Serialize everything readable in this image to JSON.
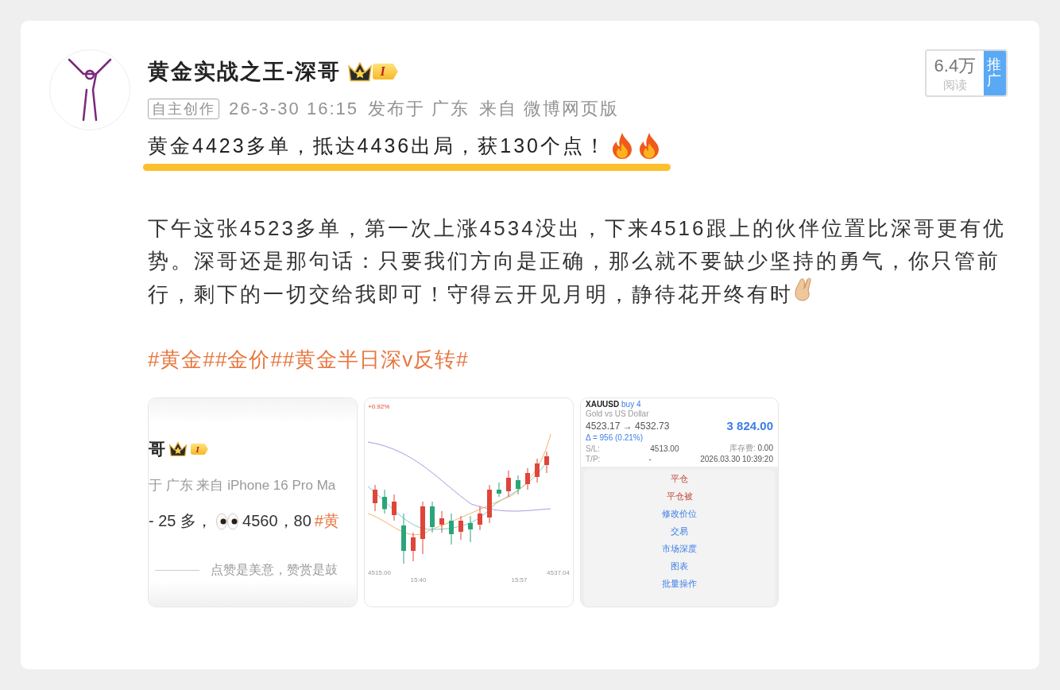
{
  "author": {
    "name": "黄金实战之王-深哥",
    "badge_level": "I"
  },
  "meta": {
    "tag": "自主创作",
    "time": "26-3-30 16:15",
    "location": "发布于 广东",
    "source": "来自 微博网页版"
  },
  "stats": {
    "reads": "6.4万",
    "reads_label": "阅读",
    "promote": "推广"
  },
  "headline": "黄金4423多单，抵达4436出局，获130个点！",
  "body": "下午这张4523多单，第一次上涨4534没出，下来4516跟上的伙伴位置比深哥更有优势。深哥还是那句话：只要我们方向是正确，那么就不要缺少坚持的勇气，你只管前行，剩下的一切交给我即可！守得云开见月明，静待花开终有时",
  "hashtags": [
    "#黄金#",
    "#金价#",
    "#黄金半日深v反转#"
  ],
  "images": [
    {
      "kind": "post",
      "name": "哥",
      "badge_level": "I",
      "meta": "于 广东 来自 iPhone 16 Pro Ma",
      "text": "- 25 多，",
      "text2": "4560，80 ",
      "tag": "#黄",
      "footer": "点赞是美意，赞赏是鼓"
    },
    {
      "kind": "chart",
      "change": "+0.92%",
      "high": "4537.04",
      "low": "4515.00",
      "times": [
        "15:40",
        "15:57"
      ]
    },
    {
      "kind": "order",
      "symbol": "XAUUSD",
      "side": "buy 4",
      "desc": "Gold vs US Dollar",
      "prices": "4523.17 → 4532.73",
      "delta": "Δ = 956 (0.21%)",
      "profit": "3 824.00",
      "rows": [
        {
          "label": "S/L:",
          "value": "4513.00",
          "label2": "库存费:",
          "value2": "0.00"
        },
        {
          "label": "T/P:",
          "value": "-",
          "label2": "",
          "value2": "2026.03.30 10:39:20"
        }
      ],
      "menu": [
        {
          "label": "平仓",
          "kind": "danger"
        },
        {
          "label": "平仓被",
          "kind": "danger"
        },
        {
          "label": "修改价位",
          "kind": "normal"
        },
        {
          "label": "交易",
          "kind": "normal"
        },
        {
          "label": "市场深度",
          "kind": "normal"
        },
        {
          "label": "图表",
          "kind": "normal"
        },
        {
          "label": "批量操作",
          "kind": "normal"
        }
      ]
    }
  ]
}
